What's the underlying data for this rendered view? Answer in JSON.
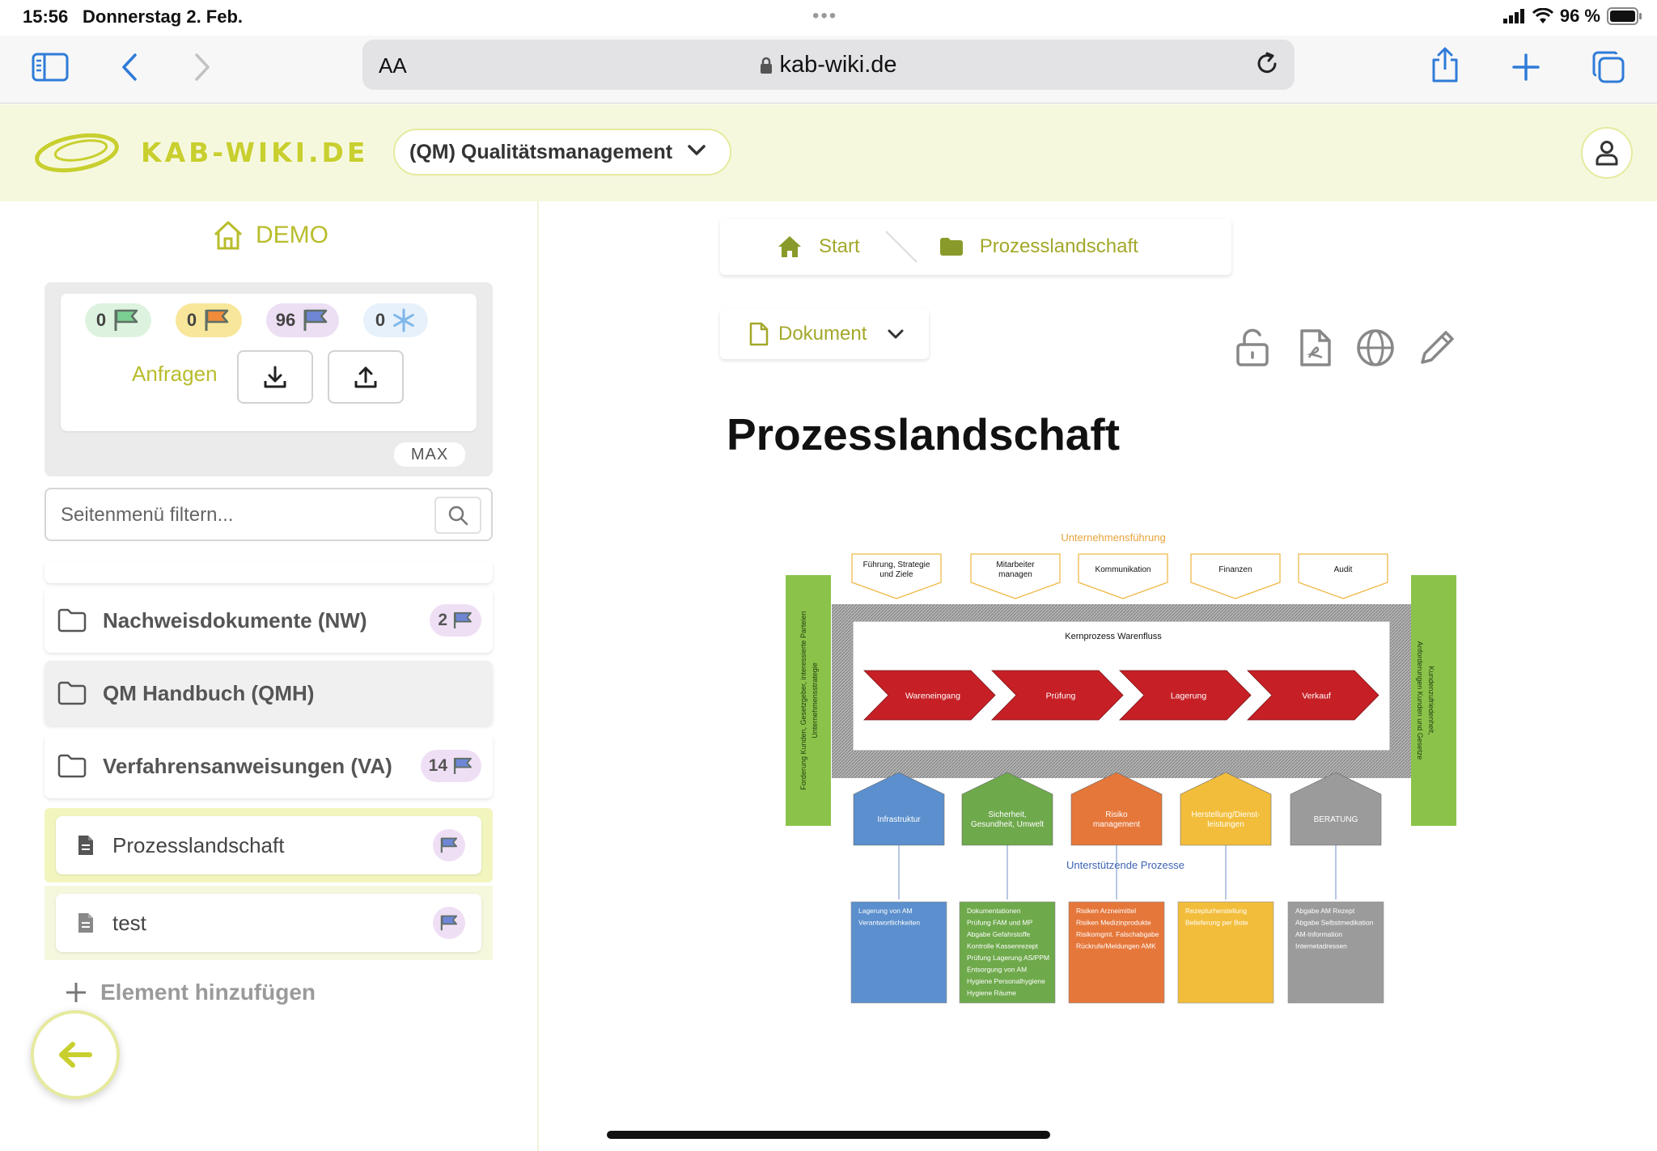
{
  "status_bar": {
    "time": "15:56",
    "date": "Donnerstag 2. Feb.",
    "battery": "96 %"
  },
  "browser": {
    "text_size_label": "AA",
    "url": "kab-wiki.de",
    "icons": [
      "sidebar-icon",
      "back-icon",
      "forward-icon",
      "lock-icon",
      "reload-icon",
      "share-icon",
      "new-tab-icon",
      "tabs-icon"
    ]
  },
  "header": {
    "logo_text": "KAB-WIKI.DE",
    "module": "(QM) Qualitätsmanagement"
  },
  "sidebar": {
    "workspace": "DEMO",
    "flag_counts": [
      {
        "value": "0",
        "color": "#7ccf92",
        "bg": "#ddf3df"
      },
      {
        "value": "0",
        "color": "#f08c3a",
        "bg": "#f8e79a"
      },
      {
        "value": "96",
        "color": "#6f86d6",
        "bg": "#ecdff4"
      },
      {
        "value": "0",
        "color": "#7fb7ea",
        "bg": "#e6f1fb"
      }
    ],
    "anfragen_label": "Anfragen",
    "max_label": "MAX",
    "filter_placeholder": "Seitenmenü filtern...",
    "folders": [
      {
        "label": "Nachweisdokumente (NW)",
        "count": "2"
      },
      {
        "label": "QM Handbuch (QMH)",
        "count": ""
      },
      {
        "label": "Verfahrensanweisungen (VA)",
        "count": "14"
      }
    ],
    "documents": [
      {
        "label": "Prozesslandschaft",
        "active": true
      },
      {
        "label": "test",
        "active": false
      }
    ],
    "add_element": "Element hinzufügen"
  },
  "main": {
    "breadcrumb": {
      "home": "Start",
      "current": "Prozesslandschaft"
    },
    "doc_type": "Dokument",
    "title": "Prozesslandschaft",
    "accent_color": "#a3a82a"
  },
  "diagram": {
    "top_title": "Unternehmensführung",
    "management": [
      [
        "Führung, Strategie",
        "und Ziele"
      ],
      [
        "Mitarbeiter",
        "managen"
      ],
      [
        "Kommunikation"
      ],
      [
        "Finanzen"
      ],
      [
        "Audit"
      ]
    ],
    "left_side": [
      "Forderung Kunden, Gesetzgeber, interessierte Parteien",
      "Unternehmensstrategie"
    ],
    "right_side": [
      "Kundenzufriedenheit,",
      "Anforderungen Kunden und Gesetze"
    ],
    "core_title": "Kernprozess Warenfluss",
    "core_steps": [
      "Wareneingang",
      "Prüfung",
      "Lagerung",
      "Verkauf"
    ],
    "support_title": "Unterstützende Prozesse",
    "support": [
      {
        "label": [
          "Infrastruktur"
        ],
        "color": "#5b8fcd",
        "items": [
          "Lagerung von AM",
          "Verantwortlichkeiten"
        ]
      },
      {
        "label": [
          "Sicherheit,",
          "Gesundheit, Umwelt"
        ],
        "color": "#6ea94b",
        "items": [
          "Dokumentationen",
          "Prüfung FAM und MP",
          "Abgabe Gefahrstoffe",
          "Kontrolle Kassenrezept",
          "Prüfung Lagerung AS/PPM",
          "Entsorgung von AM",
          "Hygiene Personalhygiene",
          "Hygiene Räume"
        ]
      },
      {
        "label": [
          "Risiko",
          "management"
        ],
        "color": "#e5773a",
        "items": [
          "Risiken Arzneimittel",
          "Risiken Medizinprodukte",
          "Risikomgmt. Falschabgabe",
          "Rückrufe/Meldungen AMK"
        ]
      },
      {
        "label": [
          "Herstellung/Dienst-",
          "leistungen"
        ],
        "color": "#f2bd3a",
        "items": [
          "Rezepturherstellung",
          "Belieferung per Bote"
        ]
      },
      {
        "label": [
          "BERATUNG"
        ],
        "color": "#9b9b9b",
        "items": [
          "Abgabe AM Rezept",
          "Abgabe Selbstmedikation",
          "AM-Information",
          "Internetadressen"
        ]
      }
    ]
  }
}
